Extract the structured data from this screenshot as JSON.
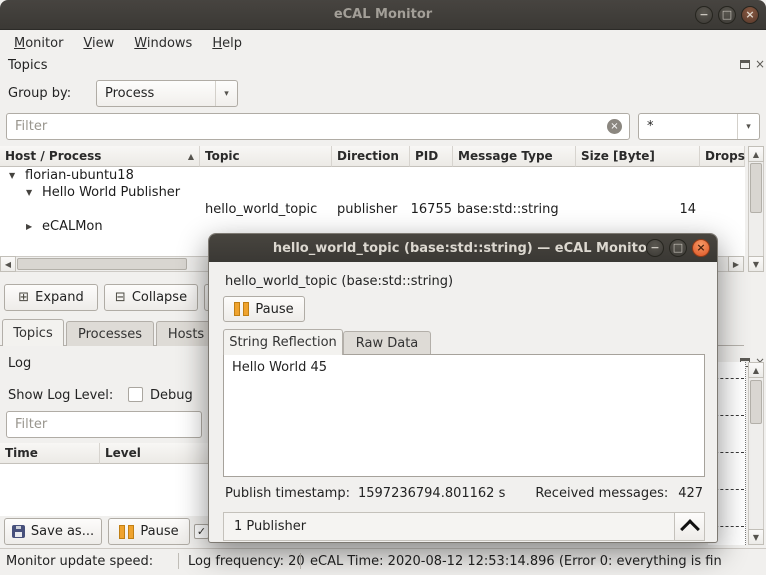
{
  "colors": {
    "titlebar": "#3c3a37",
    "close_button": "#e86b3f",
    "pause_icon": "#efa32e",
    "accent": "#e95420"
  },
  "icons": {
    "dropdown": "▾",
    "clear": "×",
    "sort_asc": "▲",
    "tree_expanded": "▼",
    "tree_collapsed": "▶",
    "scroll_left": "◀",
    "scroll_right": "▶",
    "scroll_up": "▲",
    "scroll_down": "▼",
    "minimize": "−",
    "maximize": "□",
    "close": "×",
    "check": "✓",
    "expand_all": "⊞",
    "collapse_all": "⊟"
  },
  "main": {
    "titlebar": {
      "title": "eCAL Monitor"
    },
    "menu": {
      "items": [
        {
          "mn": "M",
          "rest": "onitor"
        },
        {
          "mn": "V",
          "rest": "iew"
        },
        {
          "mn": "W",
          "rest": "indows"
        },
        {
          "mn": "H",
          "rest": "elp"
        }
      ]
    },
    "topics": {
      "title": "Topics",
      "group_by_label": "Group by:",
      "group_by_value": "Process",
      "filter_placeholder": "Filter",
      "filter_combo_value": "*",
      "columns": [
        "Host / Process",
        "Topic",
        "Direction",
        "PID",
        "Message Type",
        "Size [Byte]",
        "Drops"
      ],
      "tree": {
        "host": "florian-ubuntu18",
        "process1": "Hello World Publisher",
        "topic_row": {
          "topic": "hello_world_topic",
          "direction": "publisher",
          "pid": "16755",
          "message_type": "base:std::string",
          "size": "14"
        },
        "process2": "eCALMon"
      },
      "expand_label": "Expand",
      "collapse_label": "Collapse",
      "tabs": [
        "Topics",
        "Processes",
        "Hosts"
      ]
    },
    "log": {
      "title": "Log",
      "show_log_level_label": "Show Log Level:",
      "debug_label": "Debug",
      "filter_placeholder": "Filter",
      "columns": [
        "Time",
        "Level"
      ],
      "save_as_label": "Save as...",
      "pause_label": "Pause"
    },
    "statusbar": {
      "update_speed": "Monitor update speed:",
      "log_frequency": "Log frequency: 20",
      "ecal_time": "eCAL Time: 2020-08-12 12:53:14.896 (Error 0: everything is fin"
    }
  },
  "dialog": {
    "title": "hello_world_topic (base:std::string) — eCAL Monitor",
    "heading": "hello_world_topic (base:std::string)",
    "pause_label": "Pause",
    "tabs": [
      "String Reflection",
      "Raw Data"
    ],
    "content_text": "Hello World 45",
    "publish_timestamp_label": "Publish timestamp:",
    "publish_timestamp_value": "1597236794.801162 s",
    "received_messages_label": "Received messages:",
    "received_messages_value": "427",
    "publisher_summary": "1 Publisher"
  }
}
